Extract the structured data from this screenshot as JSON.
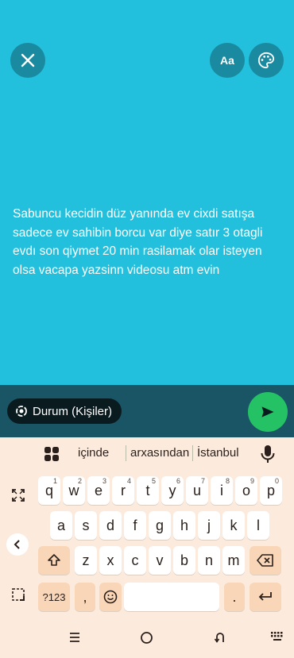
{
  "header": {
    "close_icon": "close-icon",
    "font_label": "Aa",
    "palette_icon": "palette-icon"
  },
  "status": {
    "background_color": "#22c0dc",
    "text": "Sabuncu kecidin düz yanında ev cixdi satışa sadece ev sahibin borcu var diye satır 3 otagli evdı son qiymet 20 min rasilamak olar isteyen olsa vacapa yazsinn videosu atm evin"
  },
  "footer": {
    "audience_label": "Durum (Kişiler)",
    "send_icon": "send-icon"
  },
  "keyboard": {
    "suggestions": [
      "içinde",
      "arxasından",
      "İstanbul"
    ],
    "row1": [
      {
        "k": "q",
        "h": "1"
      },
      {
        "k": "w",
        "h": "2"
      },
      {
        "k": "e",
        "h": "3"
      },
      {
        "k": "r",
        "h": "4"
      },
      {
        "k": "t",
        "h": "5"
      },
      {
        "k": "y",
        "h": "6"
      },
      {
        "k": "u",
        "h": "7"
      },
      {
        "k": "i",
        "h": "8"
      },
      {
        "k": "o",
        "h": "9"
      },
      {
        "k": "p",
        "h": "0"
      }
    ],
    "row2": [
      "a",
      "s",
      "d",
      "f",
      "g",
      "h",
      "j",
      "k",
      "l"
    ],
    "row3": [
      "z",
      "x",
      "c",
      "v",
      "b",
      "n",
      "m"
    ],
    "symbols_label": "?123",
    "comma_label": ",",
    "period_label": "."
  }
}
